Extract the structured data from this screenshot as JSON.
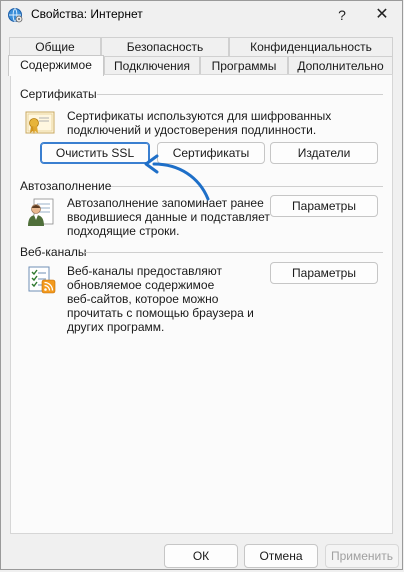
{
  "window": {
    "title": "Свойства: Интернет",
    "help_glyph": "?",
    "close_glyph": "✕"
  },
  "tabs": {
    "row1": [
      "Общие",
      "Безопасность",
      "Конфиденциальность"
    ],
    "row2": [
      "Содержимое",
      "Подключения",
      "Программы",
      "Дополнительно"
    ],
    "active": "Содержимое"
  },
  "certificates": {
    "title": "Сертификаты",
    "description": "Сертификаты используются для шифрованных\nподключений и удостоверения подлинности.",
    "clear_ssl_label": "Очистить SSL",
    "certificates_label": "Сертификаты",
    "publishers_label": "Издатели"
  },
  "autocomplete": {
    "title": "Автозаполнение",
    "description": "Автозаполнение запоминает ранее\nвводившиеся данные и подставляет\nподходящие строки.",
    "settings_label": "Параметры"
  },
  "feeds": {
    "title": "Веб-каналы",
    "description": "Веб-каналы предоставляют\nобновляемое содержимое\nвеб-сайтов, которое можно\nпрочитать с помощью браузера и\nдругих программ.",
    "settings_label": "Параметры"
  },
  "footer": {
    "ok_label": "ОК",
    "cancel_label": "Отмена",
    "apply_label": "Применить"
  },
  "colors": {
    "accent": "#3a7fd0",
    "arrow": "#1e6fc8"
  }
}
